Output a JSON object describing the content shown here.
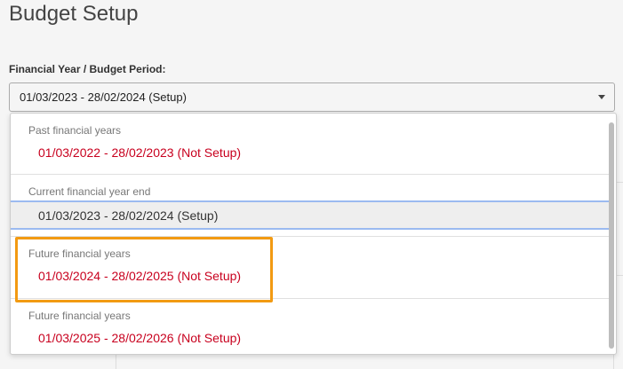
{
  "page": {
    "title": "Budget Setup"
  },
  "field": {
    "label": "Financial Year / Budget Period:",
    "selected_value": "01/03/2023 - 28/02/2024 (Setup)"
  },
  "dropdown": {
    "groups": [
      {
        "label": "Past financial years",
        "option": "01/03/2022 - 28/02/2023 (Not Setup)",
        "status": "not-setup"
      },
      {
        "label": "Current financial year end",
        "option": "01/03/2023 - 28/02/2024 (Setup)",
        "status": "selected"
      },
      {
        "label": "Future financial years",
        "option": "01/03/2024 - 28/02/2025 (Not Setup)",
        "status": "not-setup"
      },
      {
        "label": "Future financial years",
        "option": "01/03/2025 - 28/02/2026 (Not Setup)",
        "status": "not-setup"
      }
    ]
  },
  "colors": {
    "not_setup_text": "#c8001e",
    "highlight_border": "#f29a12",
    "selected_border": "#9bbaf0"
  }
}
